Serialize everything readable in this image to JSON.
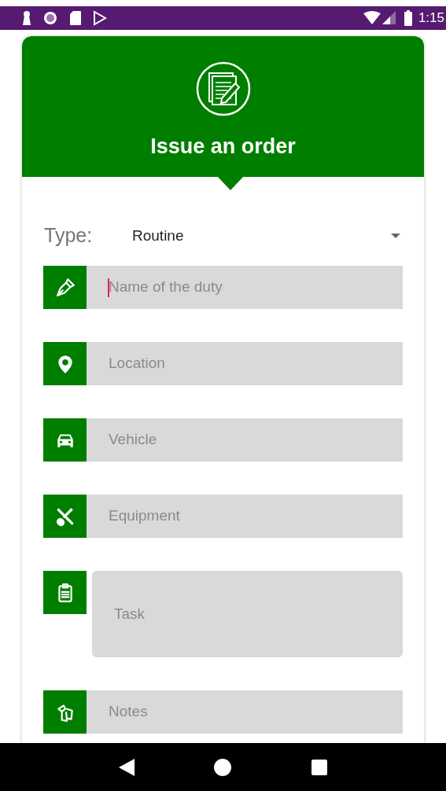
{
  "status_bar": {
    "time": "1:15"
  },
  "header": {
    "title": "Issue an order"
  },
  "type_field": {
    "label": "Type:",
    "value": "Routine"
  },
  "fields": [
    {
      "placeholder": "Name of the duty",
      "focused": true,
      "multiline": false
    },
    {
      "placeholder": "Location",
      "focused": false,
      "multiline": false
    },
    {
      "placeholder": "Vehicle",
      "focused": false,
      "multiline": false
    },
    {
      "placeholder": "Equipment",
      "focused": false,
      "multiline": false
    },
    {
      "placeholder": "Task",
      "focused": false,
      "multiline": true
    },
    {
      "placeholder": "Notes",
      "focused": false,
      "multiline": false
    }
  ]
}
